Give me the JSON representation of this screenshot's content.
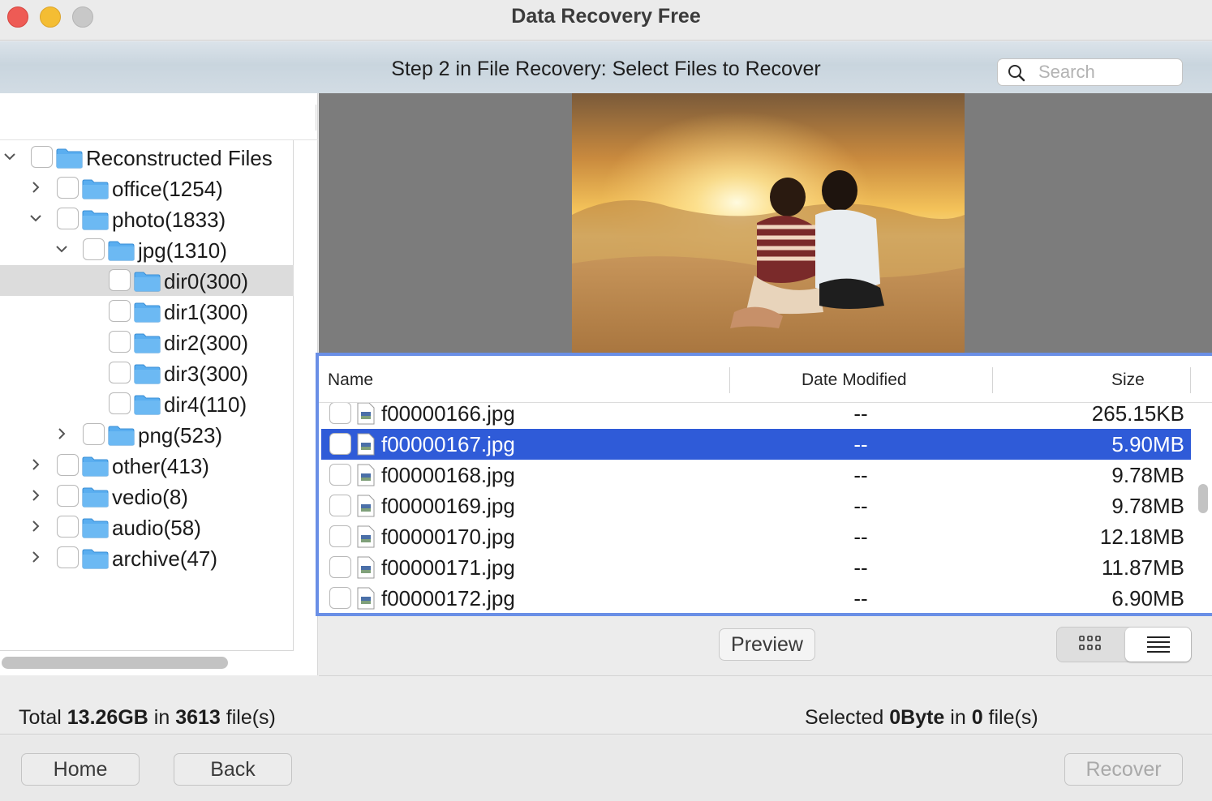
{
  "window": {
    "title": "Data Recovery Free"
  },
  "header": {
    "step_title": "Step 2 in File Recovery: Select Files to Recover",
    "search_placeholder": "Search"
  },
  "tree": {
    "items": [
      {
        "label": "Reconstructed Files",
        "expanded": true,
        "icon": "chevron-down-icon"
      },
      {
        "label": "office(1254)",
        "expanded": false,
        "icon": "chevron-right-icon"
      },
      {
        "label": "photo(1833)",
        "expanded": true,
        "icon": "chevron-down-icon"
      },
      {
        "label": "jpg(1310)",
        "expanded": true,
        "icon": "chevron-down-icon"
      },
      {
        "label": "dir0(300)",
        "selected": true
      },
      {
        "label": "dir1(300)"
      },
      {
        "label": "dir2(300)"
      },
      {
        "label": "dir3(300)"
      },
      {
        "label": "dir4(110)"
      },
      {
        "label": "png(523)",
        "expanded": false,
        "icon": "chevron-right-icon"
      },
      {
        "label": "other(413)",
        "expanded": false,
        "icon": "chevron-right-icon"
      },
      {
        "label": "vedio(8)",
        "expanded": false,
        "icon": "chevron-right-icon"
      },
      {
        "label": "audio(58)",
        "expanded": false,
        "icon": "chevron-right-icon"
      },
      {
        "label": "archive(47)",
        "expanded": false,
        "icon": "chevron-right-icon"
      }
    ]
  },
  "file_list": {
    "columns": {
      "name": "Name",
      "date": "Date Modified",
      "size": "Size"
    },
    "rows": [
      {
        "name": "f00000166.jpg",
        "date": "--",
        "size": "265.15KB",
        "selected": false
      },
      {
        "name": "f00000167.jpg",
        "date": "--",
        "size": "5.90MB",
        "selected": true
      },
      {
        "name": "f00000168.jpg",
        "date": "--",
        "size": "9.78MB",
        "selected": false
      },
      {
        "name": "f00000169.jpg",
        "date": "--",
        "size": "9.78MB",
        "selected": false
      },
      {
        "name": "f00000170.jpg",
        "date": "--",
        "size": "12.18MB",
        "selected": false
      },
      {
        "name": "f00000171.jpg",
        "date": "--",
        "size": "11.87MB",
        "selected": false
      },
      {
        "name": "f00000172.jpg",
        "date": "--",
        "size": "6.90MB",
        "selected": false
      }
    ]
  },
  "toolbar": {
    "preview_label": "Preview",
    "view_modes": [
      "grid-view-icon",
      "list-view-icon"
    ],
    "active_view": "list"
  },
  "status": {
    "total_prefix": "Total ",
    "total_size": "13.26GB",
    "total_in": " in ",
    "total_count": "3613",
    "total_suffix": " file(s)",
    "selected_prefix": "Selected ",
    "selected_size": "0Byte",
    "selected_in": " in ",
    "selected_count": "0",
    "selected_suffix": " file(s)"
  },
  "buttons": {
    "home": "Home",
    "back": "Back",
    "recover": "Recover"
  },
  "colors": {
    "selection": "#2f5bd8",
    "list_focus_border": "#6a8fe6",
    "folder": "#5aaef0",
    "close": "#ee5b55",
    "minimize": "#f4bd33"
  }
}
